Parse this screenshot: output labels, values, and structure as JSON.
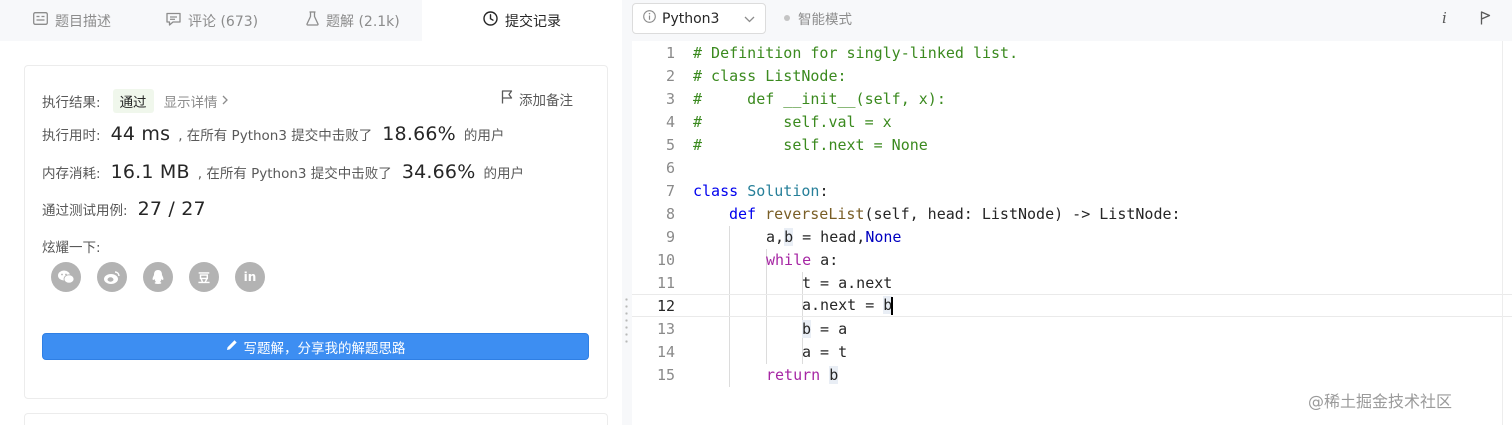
{
  "tabs": [
    {
      "label": "题目描述",
      "icon": "document-icon"
    },
    {
      "label": "评论 (673)",
      "icon": "comment-icon"
    },
    {
      "label": "题解 (2.1k)",
      "icon": "flask-icon"
    },
    {
      "label": "提交记录",
      "icon": "clock-icon",
      "active": true
    }
  ],
  "result": {
    "status_label": "执行结果:",
    "status_value": "通过",
    "details_link": "显示详情",
    "note_label": "添加备注",
    "runtime_label": "执行用时:",
    "runtime_value": "44 ms",
    "beat_text_1": ", 在所有 Python3 提交中击败了",
    "runtime_percent": "18.66%",
    "users_text": "的用户",
    "memory_label": "内存消耗:",
    "memory_value": "16.1 MB",
    "beat_text_2": ", 在所有 Python3 提交中击败了",
    "memory_percent": "34.66%",
    "users_text_2": "的用户",
    "tests_label": "通过测试用例:",
    "tests_value": "27 / 27",
    "share_label": "炫耀一下:",
    "share_icons": [
      "wechat-icon",
      "weibo-icon",
      "qq-icon",
      "douban-icon",
      "linkedin-icon"
    ],
    "linkedin_text": "in",
    "douban_text": "豆",
    "write_solution": "写题解，分享我的解题思路"
  },
  "editor": {
    "language": "Python3",
    "mode": "智能模式",
    "info_glyph": "i",
    "current_line": 12,
    "line_numbers": [
      "1",
      "2",
      "3",
      "4",
      "5",
      "6",
      "7",
      "8",
      "9",
      "10",
      "11",
      "12",
      "13",
      "14",
      "15"
    ],
    "code": {
      "l1": "# Definition for singly-linked list.",
      "l2": "# class ListNode:",
      "l3": "#     def __init__(self, x):",
      "l4": "#         self.val = x",
      "l5": "#         self.next = None",
      "l7_kw": "class",
      "l7_name": "Solution",
      "l7_rest": ":",
      "l8_kw": "def",
      "l8_fn": "reverseList",
      "l8_rest": "(self, head: ListNode) -> ListNode:",
      "l9_a": "a,",
      "l9_b": "b",
      "l9_mid": " = head,",
      "l9_none": "None",
      "l10_kw": "while",
      "l10_rest": " a:",
      "l11": "t = a.next",
      "l12_a": "a.next = ",
      "l12_b": "b",
      "l13_b": "b",
      "l13_rest": " = a",
      "l14": "a = t",
      "l15_kw": "return",
      "l15_b": "b"
    }
  },
  "watermark": "@稀土掘金技术社区"
}
